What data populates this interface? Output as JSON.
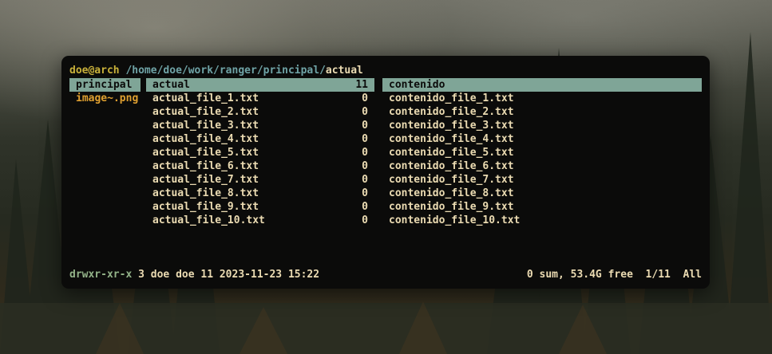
{
  "prompt": {
    "user": "doe@arch",
    "path": "/home/doe/work/ranger/principal/",
    "current": "actual"
  },
  "parent_column": {
    "items": [
      {
        "name": "principal",
        "selected": true
      },
      {
        "name": "image~.png",
        "selected": false
      }
    ]
  },
  "current_column": {
    "items": [
      {
        "name": "actual",
        "count": "11",
        "selected": true
      },
      {
        "name": "actual_file_1.txt",
        "count": "0"
      },
      {
        "name": "actual_file_2.txt",
        "count": "0"
      },
      {
        "name": "actual_file_3.txt",
        "count": "0"
      },
      {
        "name": "actual_file_4.txt",
        "count": "0"
      },
      {
        "name": "actual_file_5.txt",
        "count": "0"
      },
      {
        "name": "actual_file_6.txt",
        "count": "0"
      },
      {
        "name": "actual_file_7.txt",
        "count": "0"
      },
      {
        "name": "actual_file_8.txt",
        "count": "0"
      },
      {
        "name": "actual_file_9.txt",
        "count": "0"
      },
      {
        "name": "actual_file_10.txt",
        "count": "0"
      }
    ]
  },
  "preview_column": {
    "items": [
      {
        "name": "contenido",
        "selected": true
      },
      {
        "name": "contenido_file_1.txt"
      },
      {
        "name": "contenido_file_2.txt"
      },
      {
        "name": "contenido_file_3.txt"
      },
      {
        "name": "contenido_file_4.txt"
      },
      {
        "name": "contenido_file_5.txt"
      },
      {
        "name": "contenido_file_6.txt"
      },
      {
        "name": "contenido_file_7.txt"
      },
      {
        "name": "contenido_file_8.txt"
      },
      {
        "name": "contenido_file_9.txt"
      },
      {
        "name": "contenido_file_10.txt"
      }
    ]
  },
  "statusbar": {
    "permissions": "drwxr-xr-x",
    "info": " 3 doe doe 11 2023-11-23 15:22",
    "right": "0 sum, 53.4G free  1/11  All"
  },
  "colors": {
    "selection": "#7fa597",
    "user": "#c9b13a",
    "path": "#6fa3a6",
    "image_file": "#e0a030",
    "permissions": "#93b389",
    "text": "#ebdbb2"
  }
}
